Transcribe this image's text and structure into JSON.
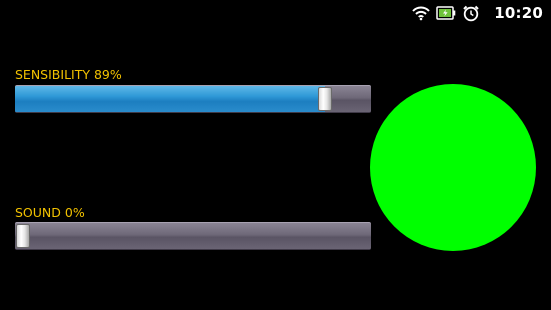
{
  "status_bar": {
    "time": "10:20",
    "icons": [
      "wifi-icon",
      "battery-icon",
      "alarm-clock-icon"
    ]
  },
  "sensibility": {
    "label": "SENSIBILITY 89%",
    "value_percent": 89
  },
  "sound": {
    "label": "SOUND 0%",
    "value_percent": 0
  },
  "indicator": {
    "color": "#00ff00"
  },
  "colors": {
    "label": "#f2c200",
    "slider_fill": "#2e98d6",
    "slider_track": "#6e6878",
    "background": "#000000"
  }
}
